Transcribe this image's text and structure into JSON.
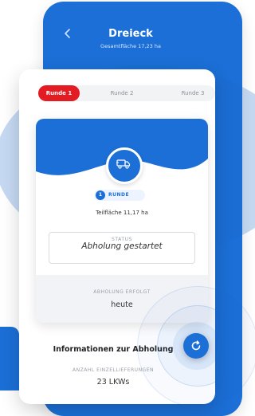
{
  "header": {
    "title": "Dreieck",
    "subtitle": "Gesamtfläche 17,23 ha"
  },
  "tabs": [
    {
      "label": "Runde 1",
      "active": true
    },
    {
      "label": "Runde 2",
      "active": false
    },
    {
      "label": "Runde 3",
      "active": false
    }
  ],
  "round": {
    "number": "1",
    "label": "RUNDE"
  },
  "area": "Teilfläche 11,17 ha",
  "status": {
    "label": "STATUS",
    "value": "Abholung gestartet"
  },
  "pickup": {
    "label": "ABHOLUNG ERFOLGT",
    "value": "heute"
  },
  "info": {
    "title": "Informationen zur Abholung",
    "count_label": "ANZAHL EINZELLIEFERUNGEN",
    "count_value": "23 LKWs"
  },
  "icons": {
    "back": "chevron-left-icon",
    "truck": "truck-icon",
    "refresh": "refresh-icon"
  },
  "colors": {
    "primary": "#1b6fd6",
    "accent": "#e31b23"
  }
}
